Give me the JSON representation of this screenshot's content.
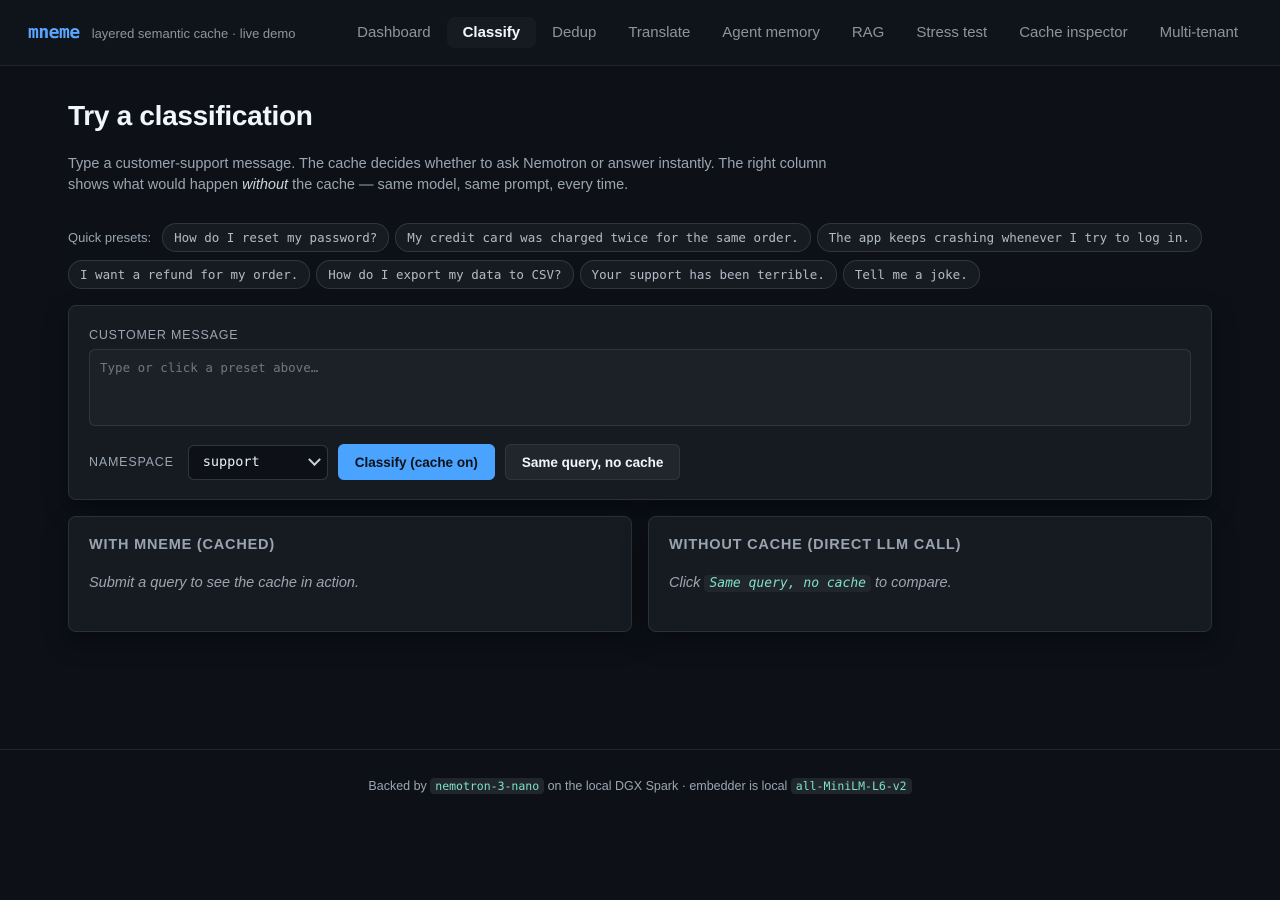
{
  "brand": {
    "name": "mneme",
    "tagline": "layered semantic cache · live demo"
  },
  "nav": {
    "tabs": [
      {
        "label": "Dashboard"
      },
      {
        "label": "Classify",
        "active": true
      },
      {
        "label": "Dedup"
      },
      {
        "label": "Translate"
      },
      {
        "label": "Agent memory"
      },
      {
        "label": "RAG"
      },
      {
        "label": "Stress test"
      },
      {
        "label": "Cache inspector"
      },
      {
        "label": "Multi-tenant"
      }
    ]
  },
  "page": {
    "title": "Try a classification",
    "intro_before": "Type a customer-support message. The cache decides whether to ask Nemotron or answer instantly. The right column shows what would happen ",
    "intro_em": "without",
    "intro_after": " the cache — same model, same prompt, every time."
  },
  "presets": {
    "label": "Quick presets:",
    "items": [
      "How do I reset my password?",
      "My credit card was charged twice for the same order.",
      "The app keeps crashing whenever I try to log in.",
      "I want a refund for my order.",
      "How do I export my data to CSV?",
      "Your support has been terrible.",
      "Tell me a joke."
    ]
  },
  "composer": {
    "label": "CUSTOMER MESSAGE",
    "placeholder": "Type or click a preset above…",
    "value": "",
    "namespace_label": "NAMESPACE",
    "namespace_value": "support",
    "classify_label": "Classify (cache on)",
    "nocache_label": "Same query, no cache"
  },
  "results": {
    "cached": {
      "title": "WITH MNEME (CACHED)",
      "body": "Submit a query to see the cache in action."
    },
    "direct": {
      "title": "WITHOUT CACHE (DIRECT LLM CALL)",
      "body_before": "Click ",
      "body_code": "Same query, no cache",
      "body_after": " to compare."
    }
  },
  "footer": {
    "text1": "Backed by ",
    "model": "nemotron-3-nano",
    "text2": " on the local DGX Spark · embedder is local ",
    "embedder": "all-MiniLM-L6-v2"
  },
  "colors": {
    "accent": "#4aa3ff",
    "background": "#0d1117",
    "card": "#161b22",
    "code": "#7ee0c8"
  }
}
